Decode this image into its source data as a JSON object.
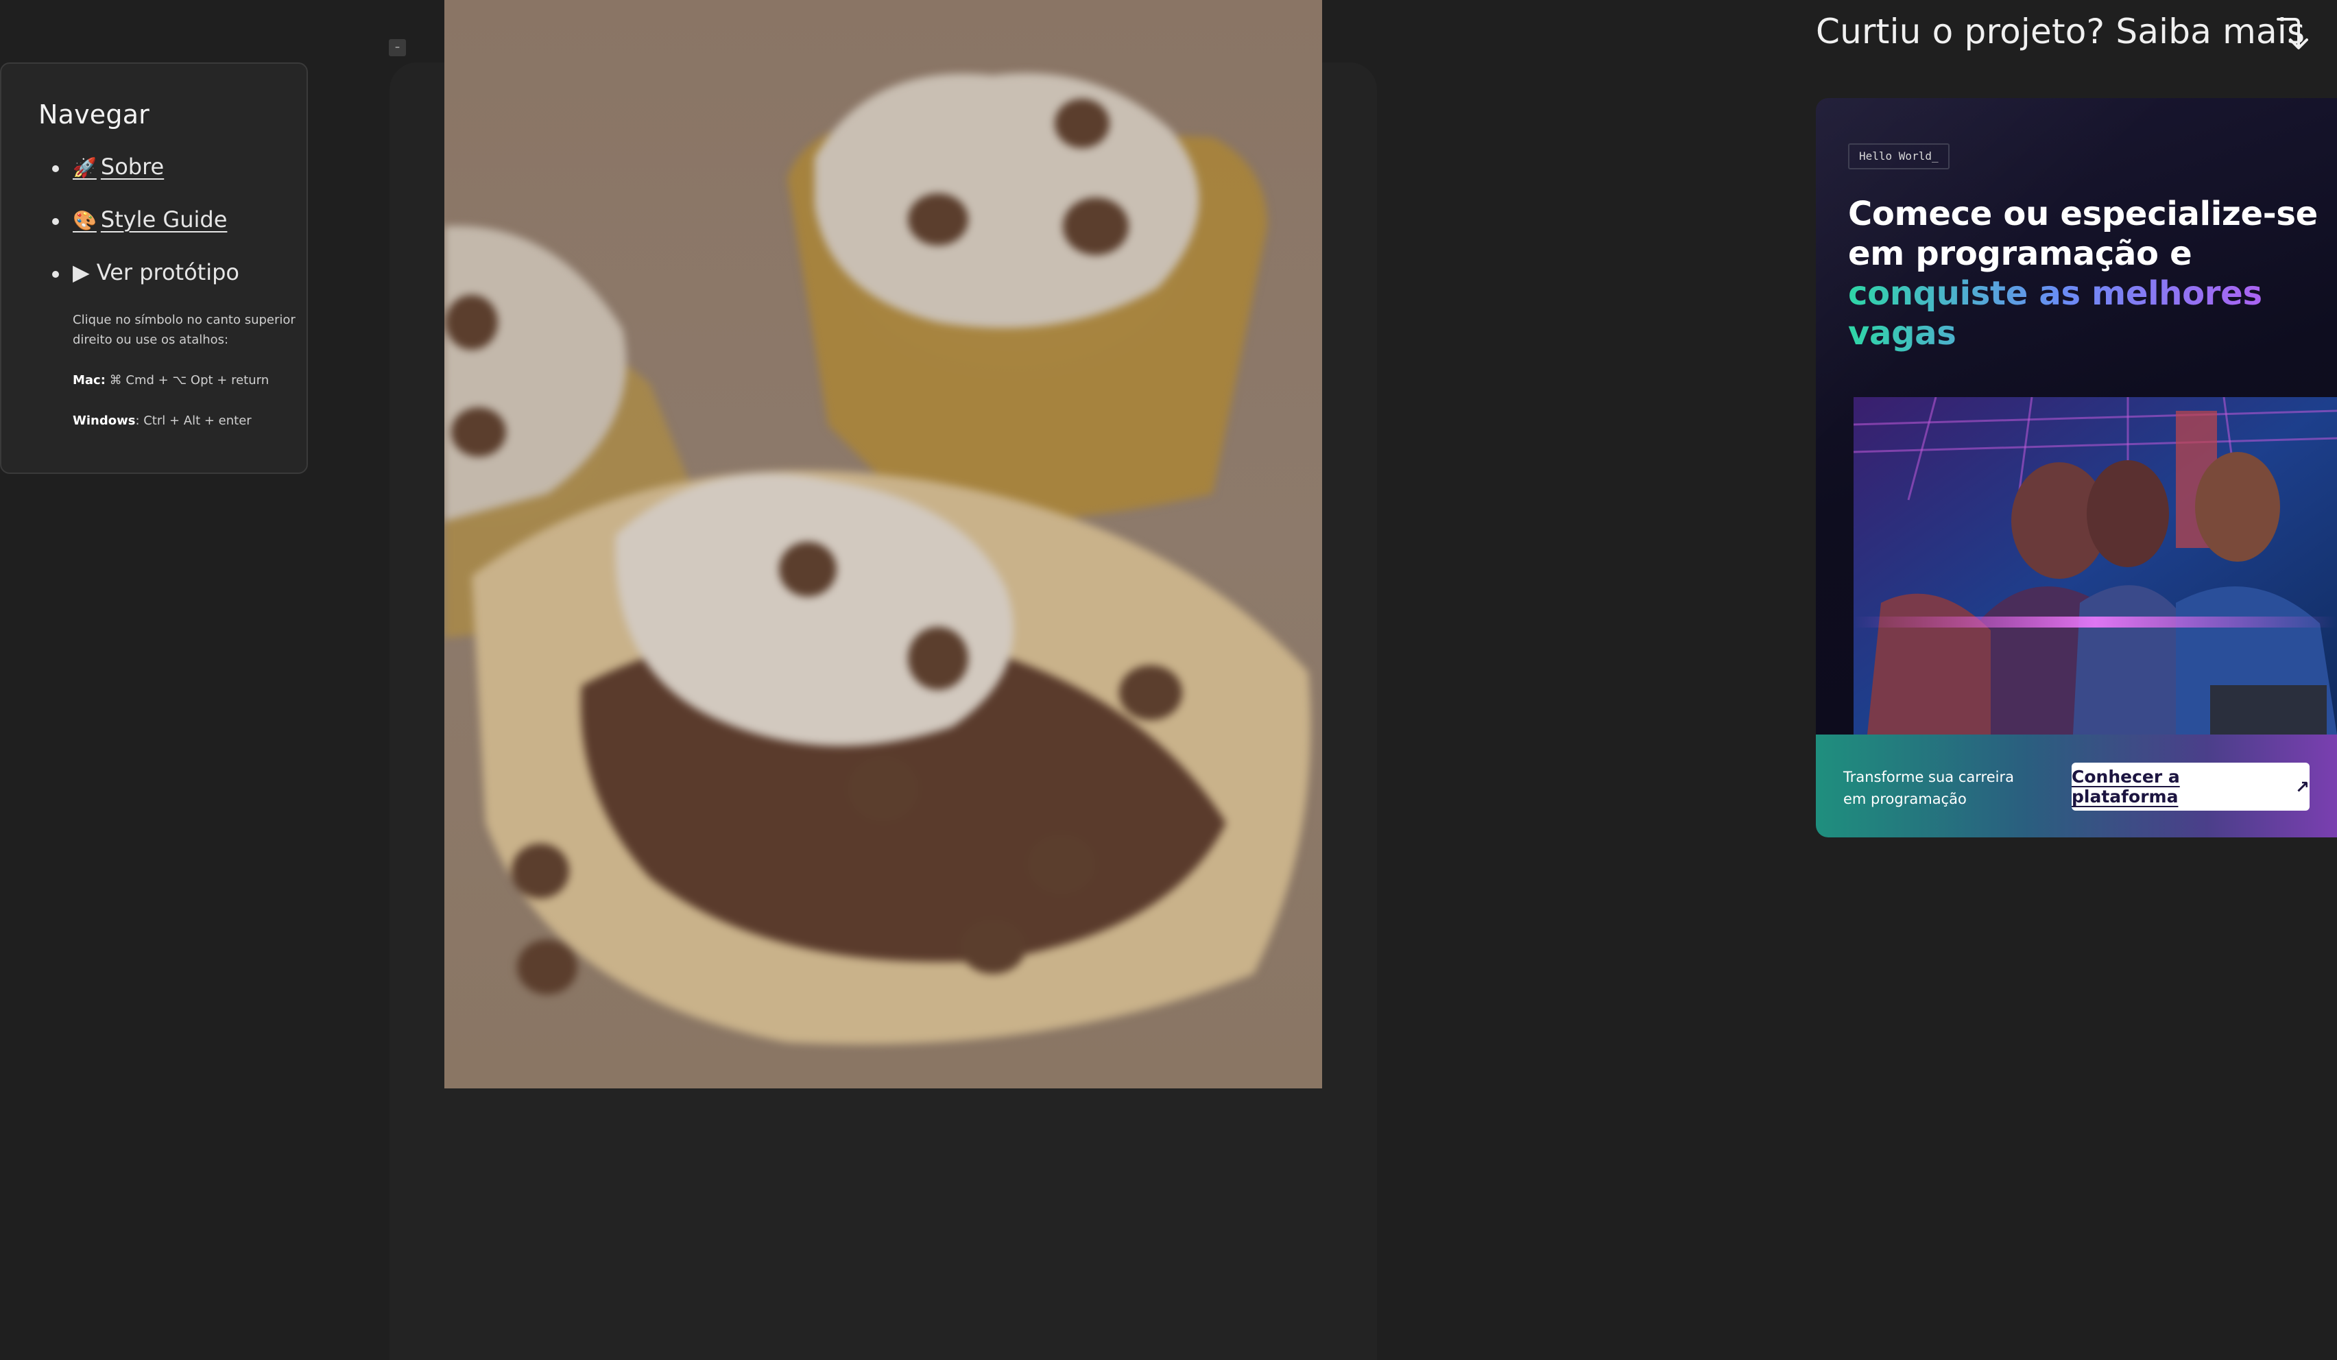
{
  "nav": {
    "title": "Navegar",
    "items": [
      {
        "emoji": "🚀",
        "label": "Sobre"
      },
      {
        "emoji": "🎨",
        "label": "Style Guide"
      },
      {
        "emoji": "▶",
        "label": "Ver protótipo"
      }
    ],
    "help": {
      "hint": "Clique no símbolo no canto superior direito ou use os atalhos:",
      "mac_label": "Mac:",
      "mac_keys": " ⌘ Cmd + ⌥ Opt + return",
      "windows_label": "Windows",
      "windows_keys": ": Ctrl + Alt + enter"
    }
  },
  "collapse_toggle": "–",
  "promo": {
    "header": "Curtiu o projeto? Saiba mais",
    "badge": "Hello World_",
    "headline_line1": "Comece ou especialize-se",
    "headline_line2": "em programação e",
    "headline_highlight": "conquiste as melhores vagas",
    "footer_text": "Transforme sua carreira em programação",
    "cta_label": "Conhecer a plataforma",
    "cta_icon": "↗"
  },
  "colors": {
    "background": "#1f1f1f",
    "nav_card": "#262626",
    "gradient_start": "#2fd6a6",
    "gradient_mid": "#6b8cf5",
    "gradient_end": "#c056f0"
  }
}
